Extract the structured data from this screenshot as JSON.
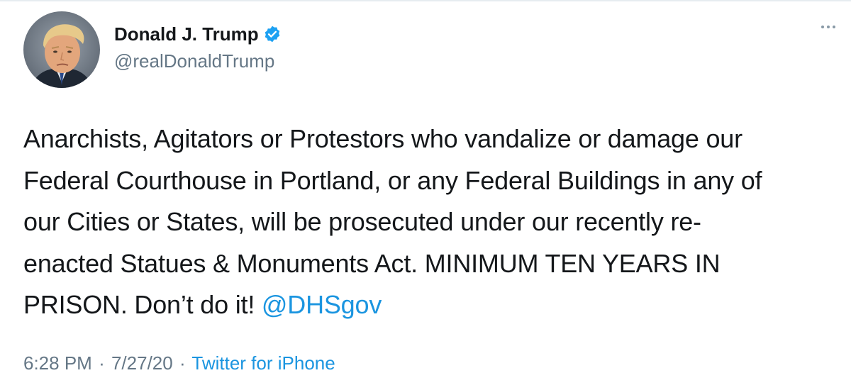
{
  "tweet": {
    "author": {
      "display_name": "Donald J. Trump",
      "handle": "@realDonaldTrump",
      "verified": true,
      "avatar_icon": "profile-photo"
    },
    "text": {
      "line1": "Anarchists, Agitators or Protestors who vandalize or damage our",
      "line2": "Federal Courthouse in Portland, or any Federal Buildings in any of",
      "line3": "our Cities or States, will be prosecuted under our recently re-",
      "line4": "enacted Statues & Monuments Act. MINIMUM TEN YEARS IN",
      "line5": "PRISON. Don’t do it! ",
      "mention": "@DHSgov"
    },
    "meta": {
      "time": "6:28 PM",
      "separator1": "·",
      "date": "7/27/20",
      "separator2": "·",
      "source": "Twitter for iPhone"
    },
    "more_icon": "more-horizontal-icon"
  },
  "colors": {
    "text": "#14171a",
    "secondary": "#657786",
    "link": "#1b95e0",
    "verified": "#1da1f2",
    "border": "#e6ecf0"
  }
}
